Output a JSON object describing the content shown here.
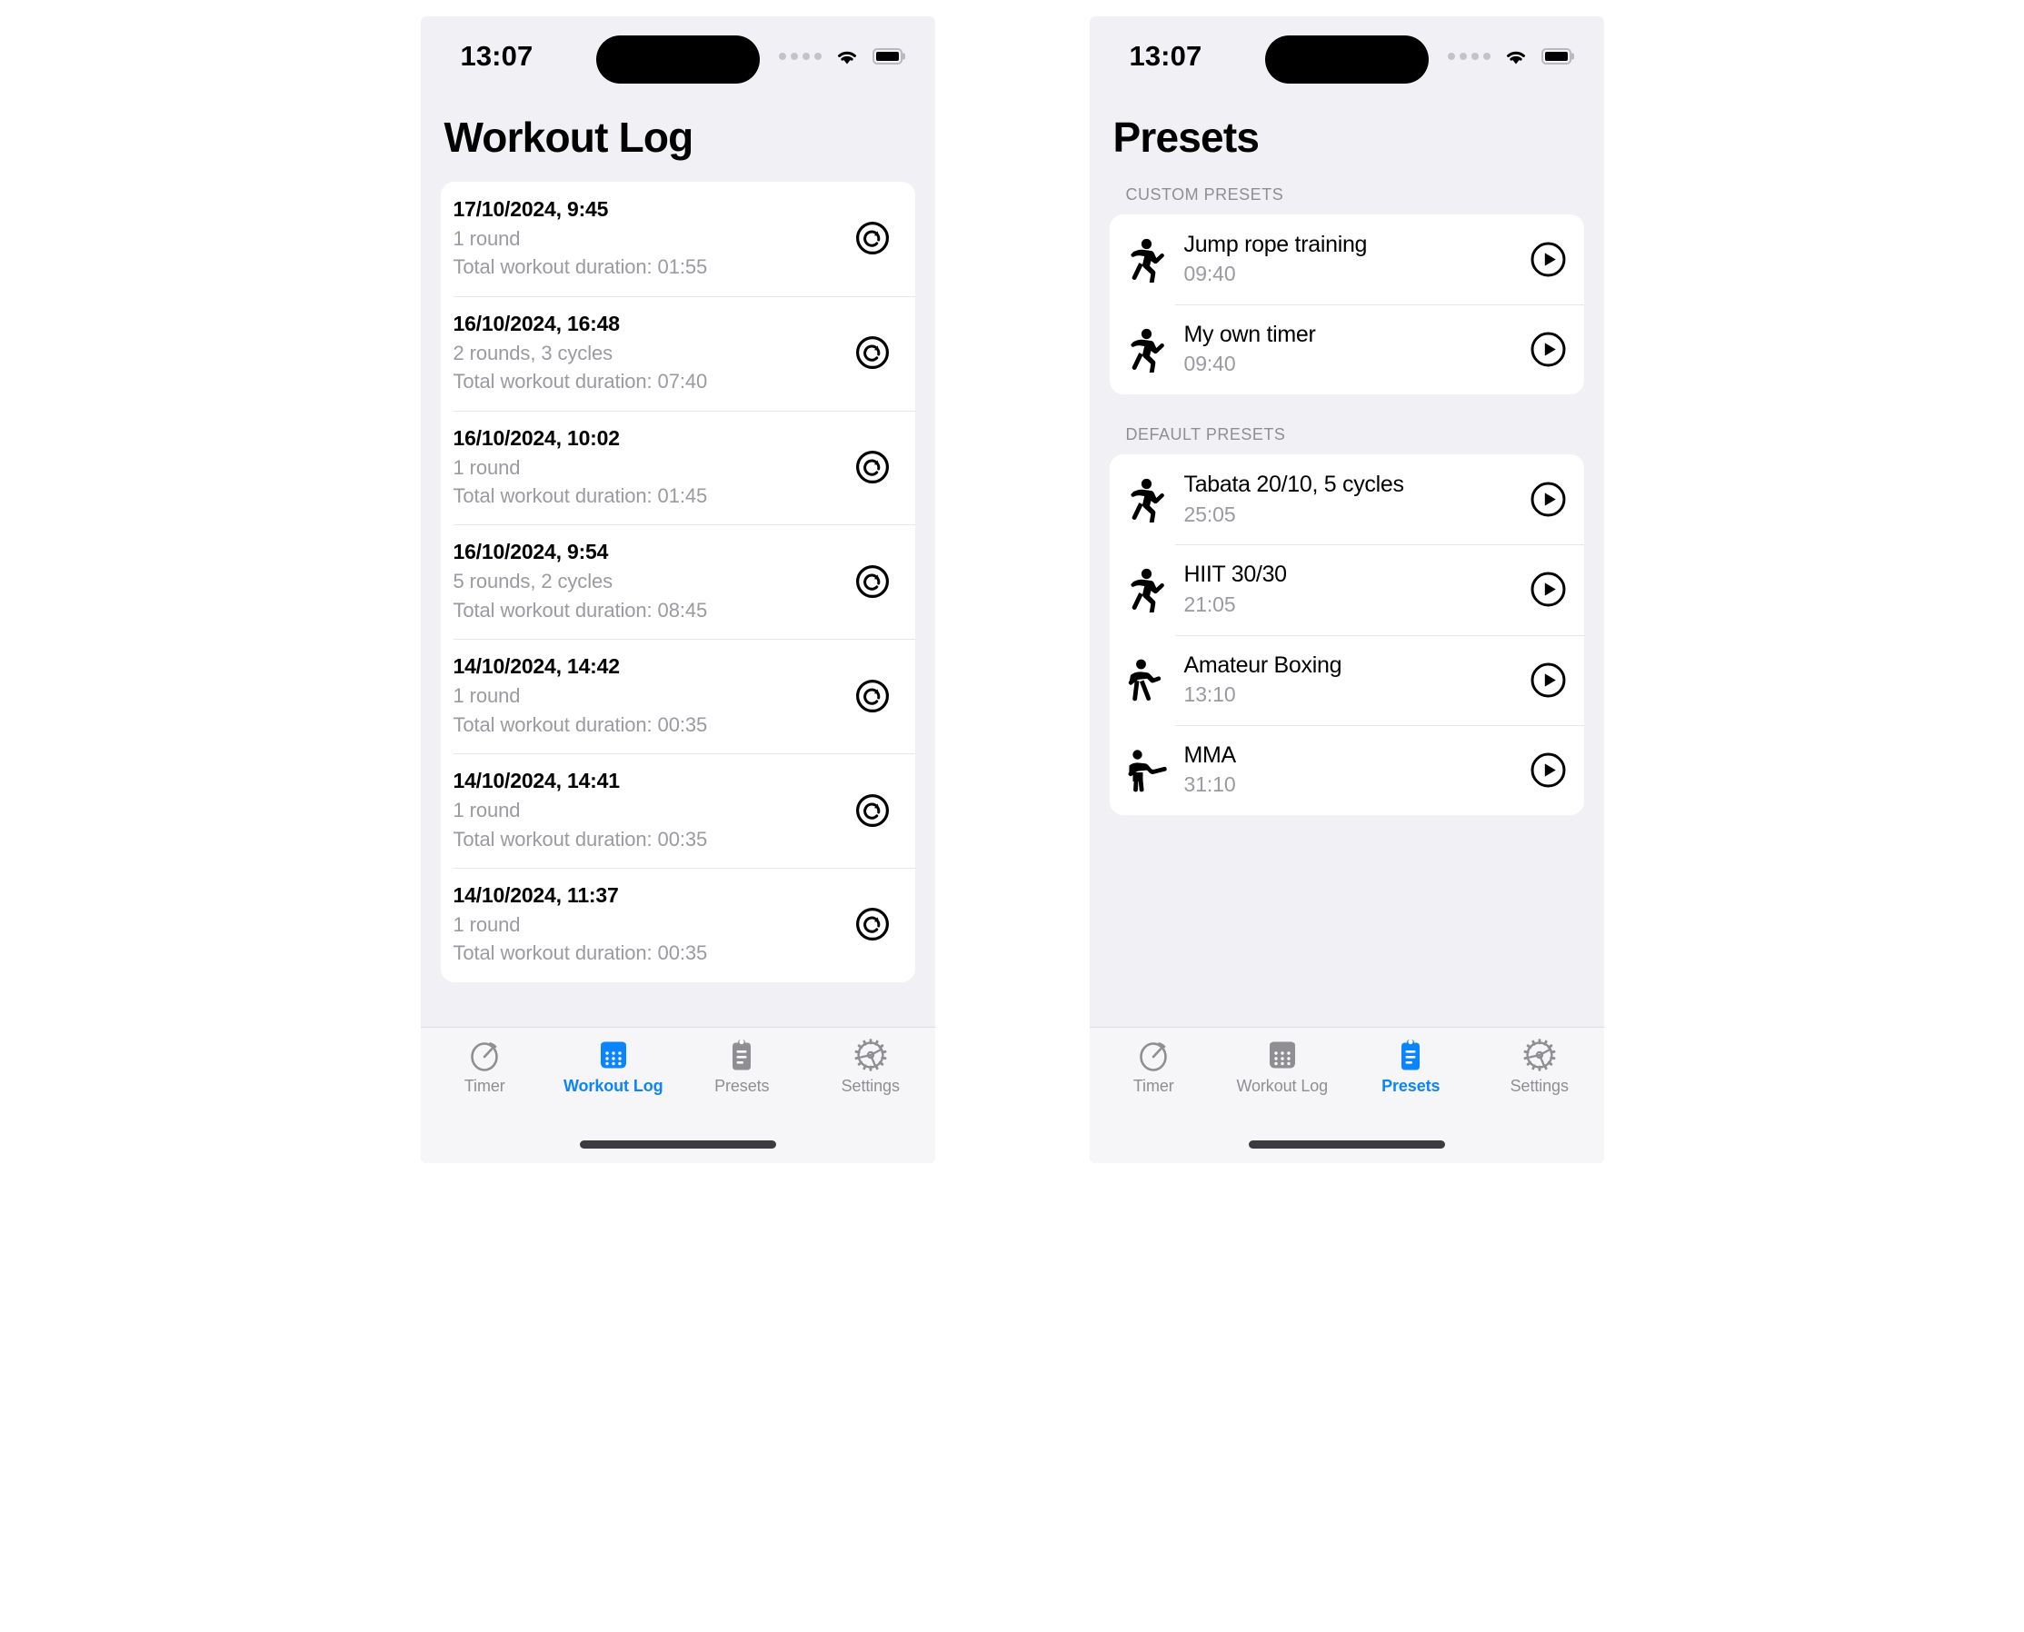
{
  "theme": {
    "accent": "#0a84ff",
    "page_background": "#f1f1f5",
    "card_background": "#ffffff",
    "secondary_text": "#9a9aa0",
    "tab_inactive": "#8e8e93"
  },
  "status_bar": {
    "time": "13:07",
    "signal_icon": "signal-dots-icon",
    "wifi_icon": "wifi-icon",
    "battery_icon": "battery-icon"
  },
  "screens": [
    {
      "id": "workout-log",
      "title": "Workout Log",
      "entries": [
        {
          "date": "17/10/2024, 9:45",
          "rounds": "1 round",
          "duration": "Total workout duration: 01:55",
          "action_icon": "restore-icon"
        },
        {
          "date": "16/10/2024, 16:48",
          "rounds": "2 rounds, 3 cycles",
          "duration": "Total workout duration: 07:40",
          "action_icon": "restore-icon"
        },
        {
          "date": "16/10/2024, 10:02",
          "rounds": "1 round",
          "duration": "Total workout duration: 01:45",
          "action_icon": "restore-icon"
        },
        {
          "date": "16/10/2024, 9:54",
          "rounds": "5 rounds, 2 cycles",
          "duration": "Total workout duration: 08:45",
          "action_icon": "restore-icon"
        },
        {
          "date": "14/10/2024, 14:42",
          "rounds": "1 round",
          "duration": "Total workout duration: 00:35",
          "action_icon": "restore-icon"
        },
        {
          "date": "14/10/2024, 14:41",
          "rounds": "1 round",
          "duration": "Total workout duration: 00:35",
          "action_icon": "restore-icon"
        },
        {
          "date": "14/10/2024, 11:37",
          "rounds": "1 round",
          "duration": "Total workout duration: 00:35",
          "action_icon": "restore-icon"
        }
      ],
      "tabs": [
        {
          "label": "Timer",
          "icon": "stopwatch-icon",
          "active": false
        },
        {
          "label": "Workout Log",
          "icon": "calendar-icon",
          "active": true
        },
        {
          "label": "Presets",
          "icon": "clipboard-icon",
          "active": false
        },
        {
          "label": "Settings",
          "icon": "gear-icon",
          "active": false
        }
      ]
    },
    {
      "id": "presets",
      "title": "Presets",
      "sections": [
        {
          "label": "CUSTOM PRESETS",
          "items": [
            {
              "name": "Jump rope training",
              "duration": "09:40",
              "icon": "running-figure-icon",
              "action_icon": "play-icon"
            },
            {
              "name": "My own timer",
              "duration": "09:40",
              "icon": "running-figure-icon",
              "action_icon": "play-icon"
            }
          ]
        },
        {
          "label": "DEFAULT PRESETS",
          "items": [
            {
              "name": "Tabata 20/10, 5 cycles",
              "duration": "25:05",
              "icon": "running-figure-icon",
              "action_icon": "play-icon"
            },
            {
              "name": "HIIT 30/30",
              "duration": "21:05",
              "icon": "running-figure-icon",
              "action_icon": "play-icon"
            },
            {
              "name": "Amateur Boxing",
              "duration": "13:10",
              "icon": "boxing-figure-icon",
              "action_icon": "play-icon"
            },
            {
              "name": "MMA",
              "duration": "31:10",
              "icon": "mma-figure-icon",
              "action_icon": "play-icon"
            }
          ]
        }
      ],
      "tabs": [
        {
          "label": "Timer",
          "icon": "stopwatch-icon",
          "active": false
        },
        {
          "label": "Workout Log",
          "icon": "calendar-icon",
          "active": false
        },
        {
          "label": "Presets",
          "icon": "clipboard-icon",
          "active": true
        },
        {
          "label": "Settings",
          "icon": "gear-icon",
          "active": false
        }
      ]
    }
  ]
}
